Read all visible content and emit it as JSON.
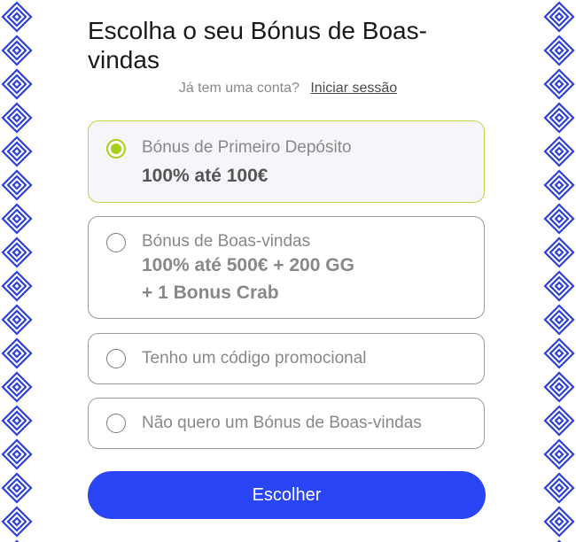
{
  "header": {
    "title": "Escolha o seu Bónus de Boas-vindas",
    "login_prompt": "Já tem uma conta?",
    "login_link": "Iniciar sessão"
  },
  "options": [
    {
      "title": "Bónus de Primeiro Depósito",
      "value": "100% até 100€",
      "selected": true
    },
    {
      "title": "Bónus de Boas-vindas",
      "value_line1": "100% até 500€ + 200 GG",
      "value_line2": "+ 1 Bonus Crab",
      "selected": false
    },
    {
      "title": "Tenho um código promocional",
      "selected": false
    },
    {
      "title": "Não quero um Bónus de Boas-vindas",
      "selected": false
    }
  ],
  "actions": {
    "choose_label": "Escolher"
  },
  "colors": {
    "accent_blue": "#2945f5",
    "selected_green": "#a6cf17",
    "border_pattern": "#2d3fd8"
  }
}
